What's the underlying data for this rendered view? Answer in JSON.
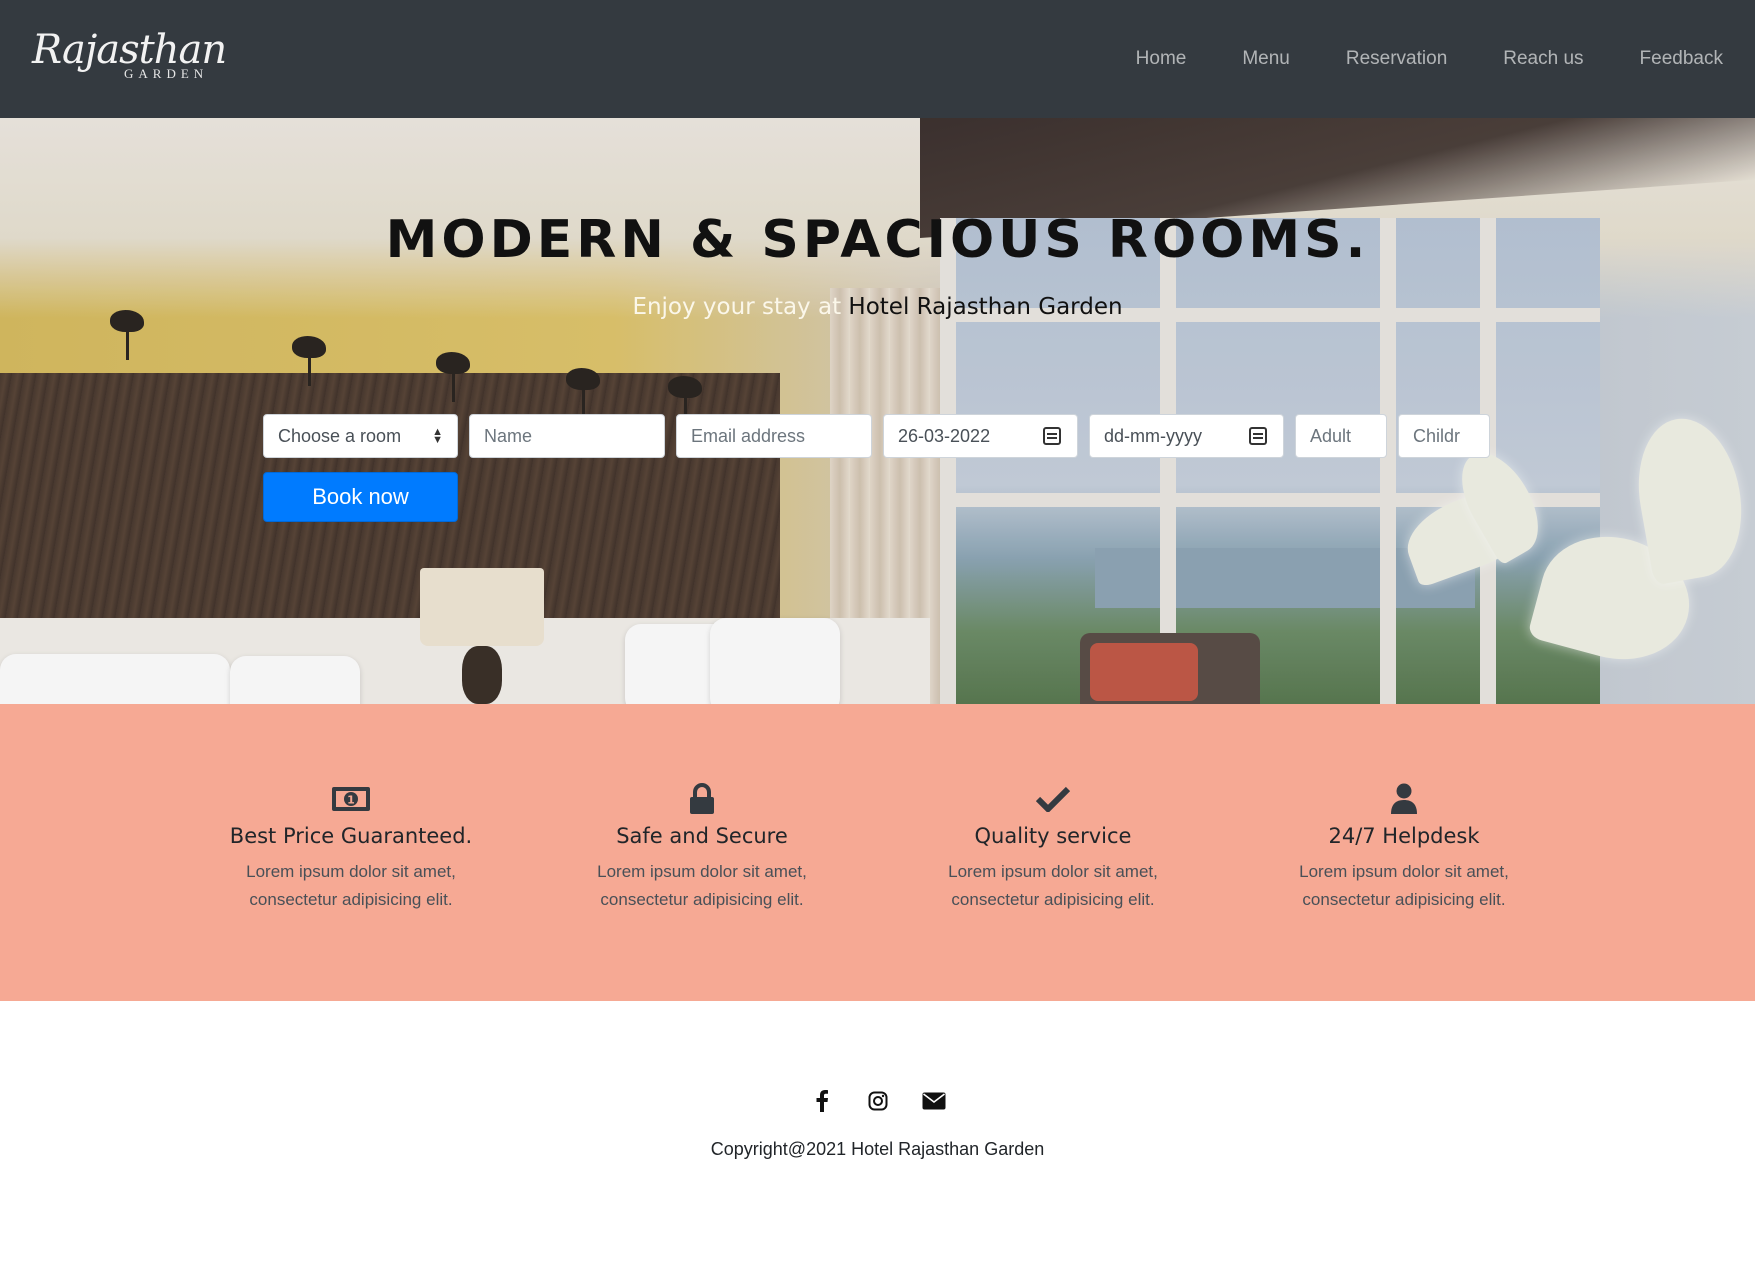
{
  "brand": {
    "logo_script": "Rajasthan",
    "logo_sub": "GARDEN"
  },
  "nav": {
    "items": [
      {
        "label": "Home"
      },
      {
        "label": "Menu"
      },
      {
        "label": "Reservation"
      },
      {
        "label": "Reach us"
      },
      {
        "label": "Feedback"
      }
    ]
  },
  "hero": {
    "title": "MODERN & SPACIOUS ROOMS.",
    "subtitle_prefix": "Enjoy your stay at",
    "subtitle_hotel": "Hotel Rajasthan Garden"
  },
  "booking": {
    "room_select": "Choose a room",
    "name_placeholder": "Name",
    "email_placeholder": "Email address",
    "checkin_value": "26-03-2022",
    "checkout_placeholder": "dd-mm-yyyy",
    "adult_placeholder": "Adult",
    "child_placeholder": "Childr",
    "book_label": "Book now"
  },
  "features": [
    {
      "icon": "money-icon",
      "title": "Best Price Guaranteed.",
      "line1": "Lorem ipsum dolor sit amet,",
      "line2": "consectetur adipisicing elit."
    },
    {
      "icon": "lock-icon",
      "title": "Safe and Secure",
      "line1": "Lorem ipsum dolor sit amet,",
      "line2": "consectetur adipisicing elit."
    },
    {
      "icon": "check-icon",
      "title": "Quality service",
      "line1": "Lorem ipsum dolor sit amet,",
      "line2": "consectetur adipisicing elit."
    },
    {
      "icon": "user-icon",
      "title": "24/7 Helpdesk",
      "line1": "Lorem ipsum dolor sit amet,",
      "line2": "consectetur adipisicing elit."
    }
  ],
  "footer": {
    "social_icons": [
      "facebook-icon",
      "instagram-icon",
      "envelope-icon"
    ],
    "copyright": "Copyright@2021 Hotel Rajasthan Garden"
  },
  "colors": {
    "navbar": "#343a40",
    "accent_button": "#007bff",
    "features_band": "#f6a994"
  }
}
